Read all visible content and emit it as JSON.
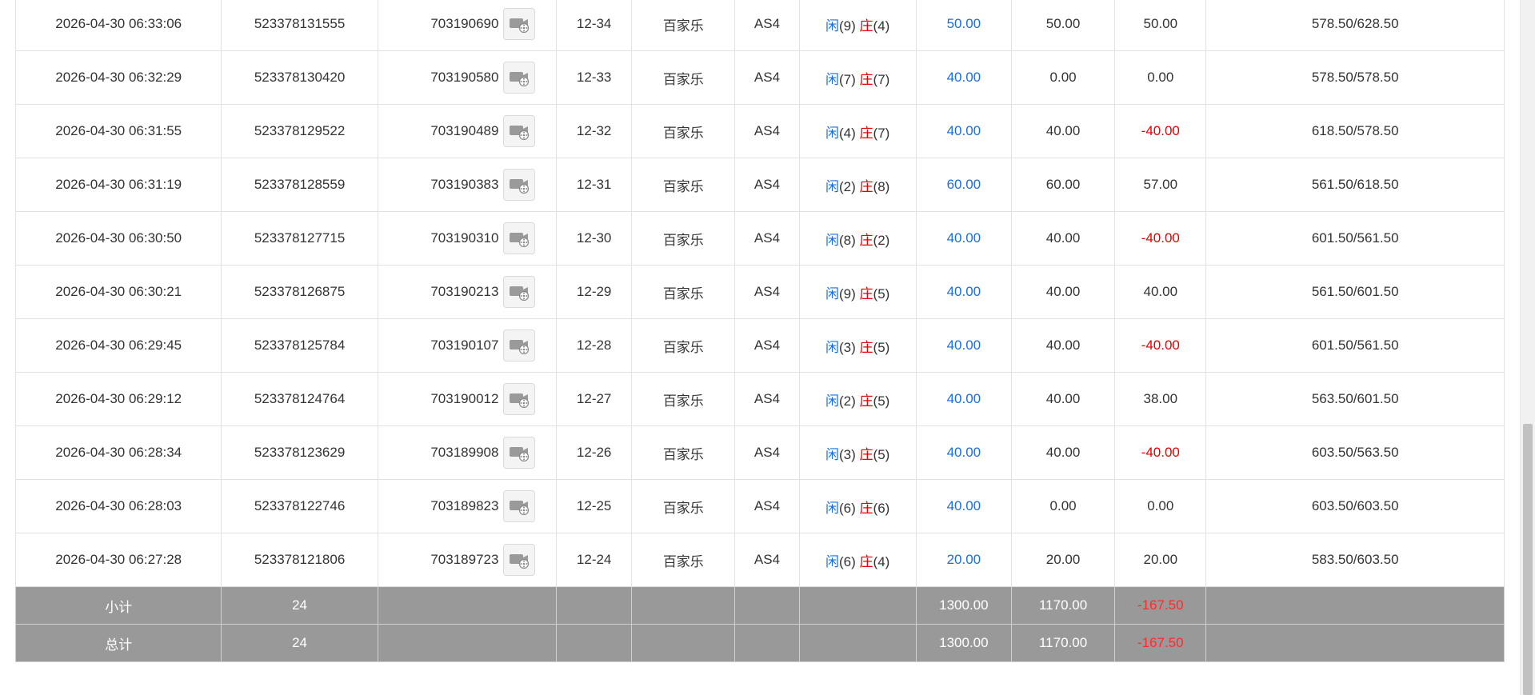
{
  "table": {
    "rows": [
      {
        "time": "2026-04-30 06:33:06",
        "bet_no": "523378131555",
        "round": "703190690",
        "shoe": "12-34",
        "game": "百家乐",
        "table": "AS4",
        "player_label": "闲",
        "player_point": "(9)",
        "banker_label": "庄",
        "banker_point": "(4)",
        "bet": "50.00",
        "valid": "50.00",
        "winloss": "50.00",
        "winloss_negative": false,
        "balance": "578.50/628.50"
      },
      {
        "time": "2026-04-30 06:32:29",
        "bet_no": "523378130420",
        "round": "703190580",
        "shoe": "12-33",
        "game": "百家乐",
        "table": "AS4",
        "player_label": "闲",
        "player_point": "(7)",
        "banker_label": "庄",
        "banker_point": "(7)",
        "bet": "40.00",
        "valid": "0.00",
        "winloss": "0.00",
        "winloss_negative": false,
        "balance": "578.50/578.50"
      },
      {
        "time": "2026-04-30 06:31:55",
        "bet_no": "523378129522",
        "round": "703190489",
        "shoe": "12-32",
        "game": "百家乐",
        "table": "AS4",
        "player_label": "闲",
        "player_point": "(4)",
        "banker_label": "庄",
        "banker_point": "(7)",
        "bet": "40.00",
        "valid": "40.00",
        "winloss": "-40.00",
        "winloss_negative": true,
        "balance": "618.50/578.50"
      },
      {
        "time": "2026-04-30 06:31:19",
        "bet_no": "523378128559",
        "round": "703190383",
        "shoe": "12-31",
        "game": "百家乐",
        "table": "AS4",
        "player_label": "闲",
        "player_point": "(2)",
        "banker_label": "庄",
        "banker_point": "(8)",
        "bet": "60.00",
        "valid": "60.00",
        "winloss": "57.00",
        "winloss_negative": false,
        "balance": "561.50/618.50"
      },
      {
        "time": "2026-04-30 06:30:50",
        "bet_no": "523378127715",
        "round": "703190310",
        "shoe": "12-30",
        "game": "百家乐",
        "table": "AS4",
        "player_label": "闲",
        "player_point": "(8)",
        "banker_label": "庄",
        "banker_point": "(2)",
        "bet": "40.00",
        "valid": "40.00",
        "winloss": "-40.00",
        "winloss_negative": true,
        "balance": "601.50/561.50"
      },
      {
        "time": "2026-04-30 06:30:21",
        "bet_no": "523378126875",
        "round": "703190213",
        "shoe": "12-29",
        "game": "百家乐",
        "table": "AS4",
        "player_label": "闲",
        "player_point": "(9)",
        "banker_label": "庄",
        "banker_point": "(5)",
        "bet": "40.00",
        "valid": "40.00",
        "winloss": "40.00",
        "winloss_negative": false,
        "balance": "561.50/601.50"
      },
      {
        "time": "2026-04-30 06:29:45",
        "bet_no": "523378125784",
        "round": "703190107",
        "shoe": "12-28",
        "game": "百家乐",
        "table": "AS4",
        "player_label": "闲",
        "player_point": "(3)",
        "banker_label": "庄",
        "banker_point": "(5)",
        "bet": "40.00",
        "valid": "40.00",
        "winloss": "-40.00",
        "winloss_negative": true,
        "balance": "601.50/561.50"
      },
      {
        "time": "2026-04-30 06:29:12",
        "bet_no": "523378124764",
        "round": "703190012",
        "shoe": "12-27",
        "game": "百家乐",
        "table": "AS4",
        "player_label": "闲",
        "player_point": "(2)",
        "banker_label": "庄",
        "banker_point": "(5)",
        "bet": "40.00",
        "valid": "40.00",
        "winloss": "38.00",
        "winloss_negative": false,
        "balance": "563.50/601.50"
      },
      {
        "time": "2026-04-30 06:28:34",
        "bet_no": "523378123629",
        "round": "703189908",
        "shoe": "12-26",
        "game": "百家乐",
        "table": "AS4",
        "player_label": "闲",
        "player_point": "(3)",
        "banker_label": "庄",
        "banker_point": "(5)",
        "bet": "40.00",
        "valid": "40.00",
        "winloss": "-40.00",
        "winloss_negative": true,
        "balance": "603.50/563.50"
      },
      {
        "time": "2026-04-30 06:28:03",
        "bet_no": "523378122746",
        "round": "703189823",
        "shoe": "12-25",
        "game": "百家乐",
        "table": "AS4",
        "player_label": "闲",
        "player_point": "(6)",
        "banker_label": "庄",
        "banker_point": "(6)",
        "bet": "40.00",
        "valid": "0.00",
        "winloss": "0.00",
        "winloss_negative": false,
        "balance": "603.50/603.50"
      },
      {
        "time": "2026-04-30 06:27:28",
        "bet_no": "523378121806",
        "round": "703189723",
        "shoe": "12-24",
        "game": "百家乐",
        "table": "AS4",
        "player_label": "闲",
        "player_point": "(6)",
        "banker_label": "庄",
        "banker_point": "(4)",
        "bet": "20.00",
        "valid": "20.00",
        "winloss": "20.00",
        "winloss_negative": false,
        "balance": "583.50/603.50"
      }
    ],
    "subtotal": {
      "label": "小计",
      "count": "24",
      "bet": "1300.00",
      "valid": "1170.00",
      "winloss": "-167.50"
    },
    "total": {
      "label": "总计",
      "count": "24",
      "bet": "1300.00",
      "valid": "1170.00",
      "winloss": "-167.50"
    }
  },
  "icons": {
    "video_icon": "video-replay-icon"
  },
  "colors": {
    "player": "#1a6fe0",
    "banker": "#e60000",
    "bet": "#1a6fe0",
    "negative": "#e60000",
    "summary_bg": "#999999"
  }
}
